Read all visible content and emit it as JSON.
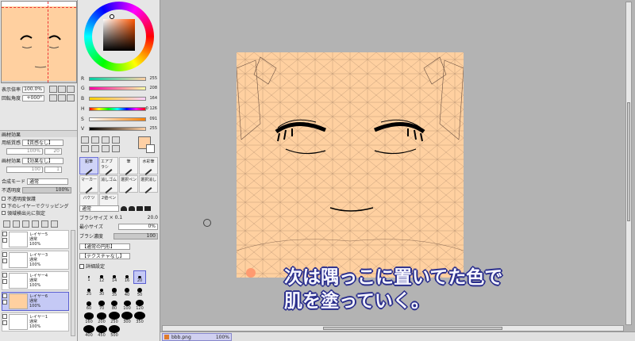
{
  "navigator": {
    "zoom_label": "表示倍率",
    "zoom_value": "100.0%",
    "rotation_label": "回転角度",
    "rotation_value": "+000°"
  },
  "paper_effect": {
    "header": "画材効果",
    "texture_label": "用紙質感",
    "texture_value": "【質感なし】",
    "texture_amount": "100%",
    "texture_strength": "20",
    "effect_label": "画材効果",
    "effect_value": "【効果なし】",
    "effect_amount": "100",
    "effect_strength": "1"
  },
  "layer_props": {
    "blend_label": "合成モード",
    "blend_value": "通常",
    "opacity_label": "不透明度",
    "opacity_value": "100%",
    "opt_protect": "不透明度保護",
    "opt_clip": "下のレイヤーでクリッピング",
    "opt_select_src": "領域検出元に指定"
  },
  "layers": [
    {
      "name": "レイヤー5",
      "mode": "通常",
      "opacity": "100%"
    },
    {
      "name": "レイヤー3",
      "mode": "通常",
      "opacity": "100%"
    },
    {
      "name": "レイヤー4",
      "mode": "通常",
      "opacity": "100%"
    },
    {
      "name": "レイヤー6",
      "mode": "通常",
      "opacity": "100%"
    },
    {
      "name": "レイヤー1",
      "mode": "通常",
      "opacity": "100%"
    }
  ],
  "color": {
    "r_label": "R",
    "r_value": "255",
    "g_label": "G",
    "g_value": "208",
    "b_label": "B",
    "b_value": "164",
    "h_label": "H",
    "h_value": "0 126",
    "s_label": "S",
    "s_value": "091",
    "v_label": "V",
    "v_value": "255",
    "current": "#ffd0a4"
  },
  "tools": [
    {
      "label": "鉛筆",
      "selected": true
    },
    {
      "label": "エアブラシ",
      "selected": false
    },
    {
      "label": "筆",
      "selected": false
    },
    {
      "label": "水彩筆",
      "selected": false
    },
    {
      "label": "マーカー",
      "selected": false
    },
    {
      "label": "消しゴム",
      "selected": false
    },
    {
      "label": "選択ペン",
      "selected": false
    },
    {
      "label": "選択消し",
      "selected": false
    },
    {
      "label": "バケツ",
      "selected": false
    },
    {
      "label": "2値ペン",
      "selected": false
    }
  ],
  "brush": {
    "mode_value": "通常",
    "size_label": "ブラシサイズ",
    "size_mult": "× 0.1",
    "size_value": "20.0",
    "min_size_label": "最小サイズ",
    "min_size_value": "0%",
    "density_label": "ブラシ濃度",
    "density_value": "100",
    "shape_value": "【通常の円形】",
    "texture_value": "【テクスチャなし】",
    "detail_label": "詳細設定"
  },
  "brush_sizes": [
    "1",
    "12",
    "14",
    "16",
    "20",
    "25",
    "30",
    "35",
    "40",
    "50",
    "60",
    "70",
    "80",
    "100",
    "120",
    "160",
    "200",
    "250",
    "300",
    "350",
    "400",
    "450",
    "500"
  ],
  "caption": {
    "line1": "次は隅っこに置いてた色で",
    "line2": "肌を塗っていく。"
  },
  "status": {
    "file": "bbb.png",
    "zoom": "100%"
  }
}
